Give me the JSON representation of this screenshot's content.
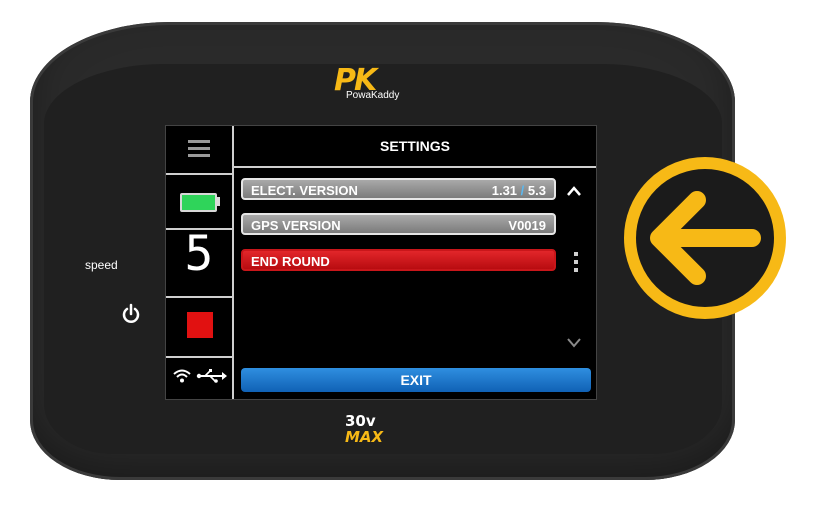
{
  "device": {
    "logo_mark": "PK",
    "logo_text": "PowaKaddy",
    "speed_label": "speed",
    "badge_top": "30v",
    "badge_bottom": "MAX",
    "accent_color": "#f7b916"
  },
  "screen": {
    "title": "SETTINGS",
    "speed_value": "5",
    "rows": [
      {
        "label": "ELECT.  VERSION",
        "value_a": "1.31",
        "separator": "/",
        "value_b": "5.3",
        "style": "gray"
      },
      {
        "label": "GPS VERSION",
        "value": "V0019",
        "style": "gray"
      },
      {
        "label": "END ROUND",
        "value": "",
        "style": "red"
      }
    ],
    "exit_label": "EXIT",
    "colors": {
      "battery": "#2fd45a",
      "stop": "#e11111",
      "exit": "#1f7ad0",
      "end_round": "#d01a1e",
      "row_gray": "#8f8f8f"
    },
    "icons": [
      "menu-icon",
      "battery-icon",
      "stop-icon",
      "wifi-icon",
      "usb-icon",
      "chevron-up-icon",
      "more-dots-icon",
      "chevron-down-icon",
      "power-icon",
      "arrow-left-icon"
    ]
  }
}
